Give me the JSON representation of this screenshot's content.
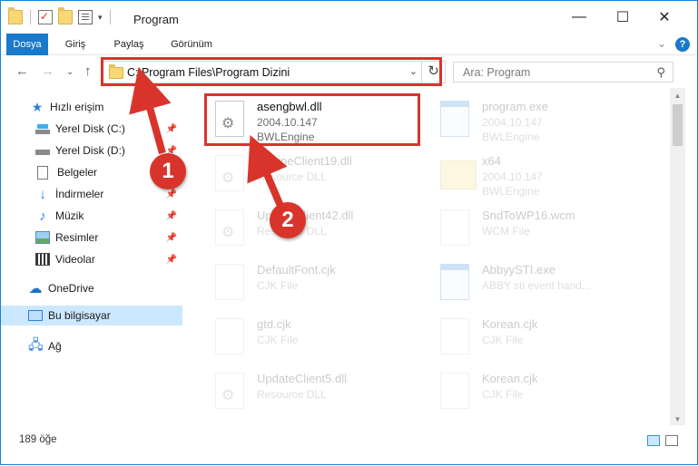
{
  "window": {
    "title": "Program",
    "controls": {
      "minimize": "—",
      "maximize": "☐",
      "close": "✕"
    }
  },
  "ribbon": {
    "tabs": [
      {
        "label": "Dosya",
        "active": true
      },
      {
        "label": "Giriş"
      },
      {
        "label": "Paylaş"
      },
      {
        "label": "Görünüm"
      }
    ],
    "help": "?",
    "collapse": "⌄"
  },
  "nav": {
    "back": "←",
    "forward": "→",
    "recent": "⌄",
    "up": "↑",
    "address_path": "C:\\Program Files\\Program Dizini",
    "address_dropdown": "⌄",
    "refresh": "↻",
    "search_placeholder": "Ara: Program",
    "search_icon": "search-icon"
  },
  "sidebar": {
    "items": [
      {
        "label": "Hızlı erişim",
        "icon": "star-icon"
      },
      {
        "label": "Yerel Disk (C:)",
        "icon": "disk-icon",
        "pinned": true
      },
      {
        "label": "Yerel Disk (D:)",
        "icon": "disk-icon",
        "pinned": true
      },
      {
        "label": "Belgeler",
        "icon": "document-icon",
        "pinned": true
      },
      {
        "label": "İndirmeler",
        "icon": "download-icon",
        "pinned": true
      },
      {
        "label": "Müzik",
        "icon": "music-icon",
        "pinned": true
      },
      {
        "label": "Resimler",
        "icon": "pictures-icon",
        "pinned": true
      },
      {
        "label": "Videolar",
        "icon": "videos-icon",
        "pinned": true
      },
      {
        "label": "OneDrive",
        "icon": "cloud-icon"
      },
      {
        "label": "Bu bilgisayar",
        "icon": "computer-icon",
        "selected": true
      },
      {
        "label": "Ağ",
        "icon": "network-icon"
      }
    ]
  },
  "files": [
    {
      "name": "asengbwl.dll",
      "line1": "2004.10.147",
      "line2": "BWLEngine",
      "icon": "dll-icon",
      "highlighted": true
    },
    {
      "name": "program.exe",
      "line1": "2004.10.147",
      "line2": "BWLEngine",
      "icon": "exe-icon"
    },
    {
      "name": "EngineClient19.dll",
      "line1": "Resource DLL",
      "line2": "",
      "icon": "dll-icon"
    },
    {
      "name": "x64",
      "line1": "2004.10.147",
      "line2": "BWLEngine",
      "icon": "folder-icon"
    },
    {
      "name": "UpdateClient42.dll",
      "line1": "Resource DLL",
      "line2": "",
      "icon": "dll-icon"
    },
    {
      "name": "SndToWP16.wcm",
      "line1": "WCM File",
      "line2": "",
      "icon": "file-icon"
    },
    {
      "name": "DefaultFont.cjk",
      "line1": "CJK File",
      "line2": "",
      "icon": "file-icon"
    },
    {
      "name": "AbbyySTI.exe",
      "line1": "ABBY sti event hand...",
      "line2": "",
      "icon": "exe-icon"
    },
    {
      "name": "gtd.cjk",
      "line1": "CJK File",
      "line2": "",
      "icon": "file-icon"
    },
    {
      "name": "Korean.cjk",
      "line1": "CJK File",
      "line2": "",
      "icon": "file-icon"
    },
    {
      "name": "UpdateClient5.dll",
      "line1": "Resource DLL",
      "line2": "",
      "icon": "dll-icon"
    },
    {
      "name": "Korean.cjk",
      "line1": "CJK File",
      "line2": "",
      "icon": "file-icon"
    }
  ],
  "status": {
    "item_count": "189 öğe",
    "views": [
      "details-view-icon",
      "tiles-view-icon"
    ]
  },
  "annotations": {
    "step1": "1",
    "step2": "2",
    "color": "#d9342b"
  }
}
